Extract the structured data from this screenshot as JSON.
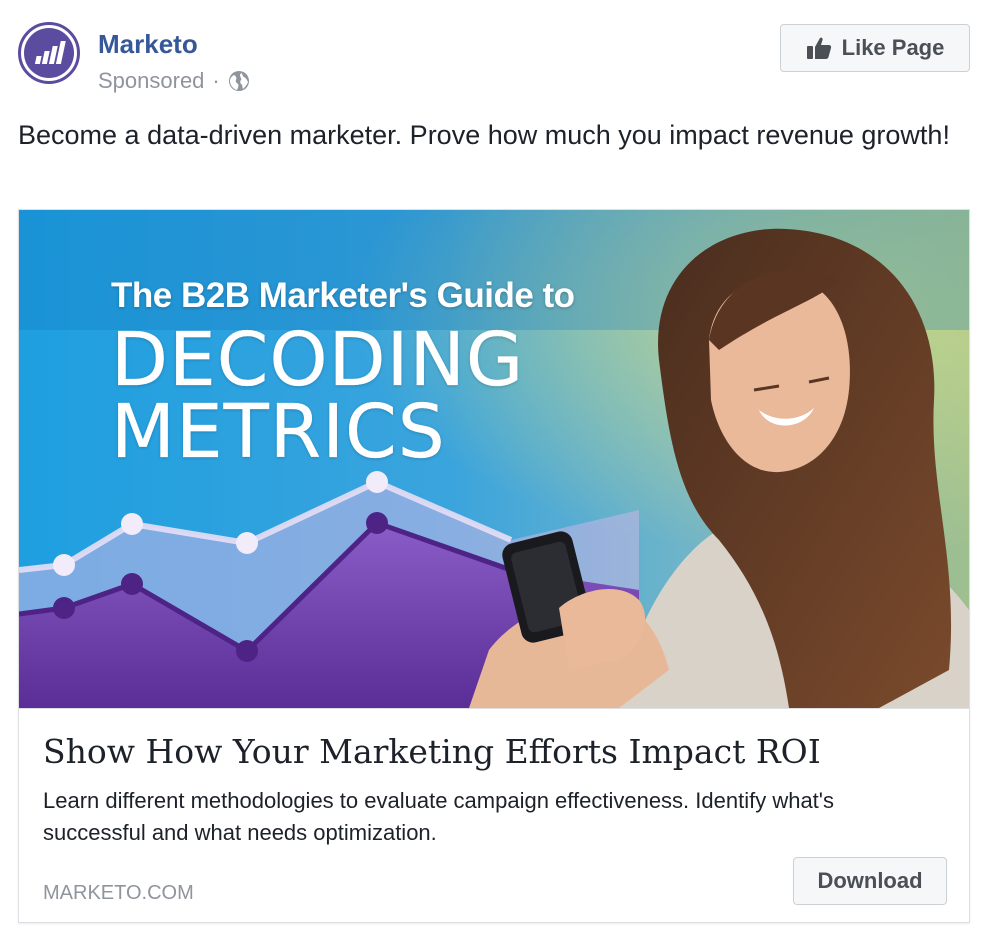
{
  "header": {
    "page_name": "Marketo",
    "sponsored_label": "Sponsored",
    "separator": "·",
    "like_button_label": "Like Page",
    "avatar_icon": "marketo-bars-logo",
    "audience_icon": "globe-icon"
  },
  "post": {
    "text": "Become a data-driven marketer. Prove how much you impact revenue growth!"
  },
  "creative": {
    "line1": "The B2B Marketer's Guide to",
    "line2": "DECODING",
    "line3": "METRICS"
  },
  "link": {
    "headline": "Show How Your Marketing Efforts Impact ROI",
    "description": "Learn different methodologies to evaluate campaign effectiveness. Identify what's successful and what needs optimization.",
    "domain": "MARKETO.COM",
    "cta_label": "Download"
  },
  "colors": {
    "brand_link": "#365899",
    "marketo_purple": "#5c4c9f",
    "meta_gray": "#90949c",
    "text": "#1d2129"
  }
}
